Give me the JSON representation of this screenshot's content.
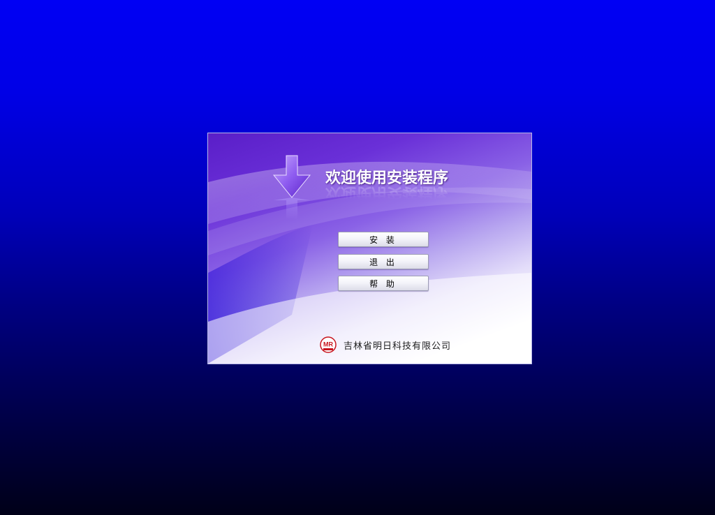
{
  "window": {
    "title": "欢迎使用安装程序"
  },
  "buttons": {
    "install": "安 装",
    "exit": "退 出",
    "help": "帮 助"
  },
  "footer": {
    "logo_text": "MR",
    "company": "吉林省明日科技有限公司"
  },
  "icons": {
    "arrow": "download-arrow-icon",
    "logo": "mr-logo-icon"
  },
  "colors": {
    "background_top": "#0000f4",
    "background_bottom": "#000018",
    "panel_purple": "#5a1ec8",
    "logo_red": "#c8141e"
  }
}
